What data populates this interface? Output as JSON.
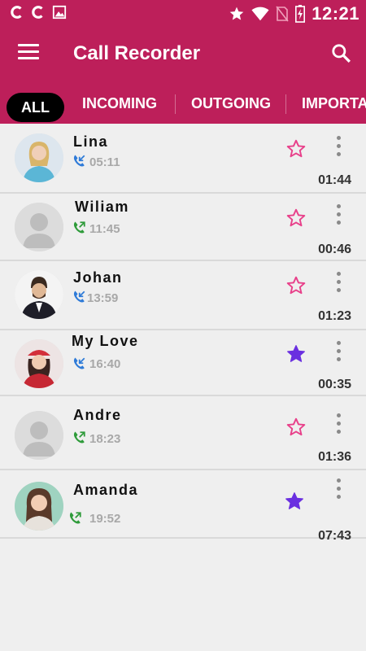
{
  "status_bar": {
    "time": "12:21",
    "icons": [
      "c-app-icon",
      "c-app-icon",
      "image-icon",
      "star-icon",
      "wifi-icon",
      "no-sim-icon",
      "battery-charging-icon"
    ]
  },
  "app_bar": {
    "title": "Call Recorder",
    "menu_icon": "hamburger-menu-icon",
    "search_icon": "search-icon"
  },
  "tabs": [
    {
      "label": "ALL",
      "active": true
    },
    {
      "label": "INCOMING",
      "active": false
    },
    {
      "label": "OUTGOING",
      "active": false
    },
    {
      "label": "IMPORTANT",
      "active": false
    }
  ],
  "calls": [
    {
      "name": "Lina",
      "time": "05:11",
      "direction": "incoming",
      "duration": "01:44",
      "starred": false
    },
    {
      "name": "Wiliam",
      "time": "11:45",
      "direction": "outgoing",
      "duration": "00:46",
      "starred": false
    },
    {
      "name": "Johan",
      "time": "13:59",
      "direction": "incoming",
      "duration": "01:23",
      "starred": false
    },
    {
      "name": "My Love",
      "time": "16:40",
      "direction": "incoming",
      "duration": "00:35",
      "starred": true
    },
    {
      "name": "Andre",
      "time": "18:23",
      "direction": "outgoing",
      "duration": "01:36",
      "starred": false
    },
    {
      "name": "Amanda",
      "time": "19:52",
      "direction": "outgoing",
      "duration": "07:43",
      "starred": true
    }
  ],
  "colors": {
    "primary": "#bd1f5a",
    "incoming": "#2f7bd8",
    "outgoing": "#2e9b3a",
    "star_outline": "#e8408a",
    "star_filled": "#6a2fe0"
  }
}
